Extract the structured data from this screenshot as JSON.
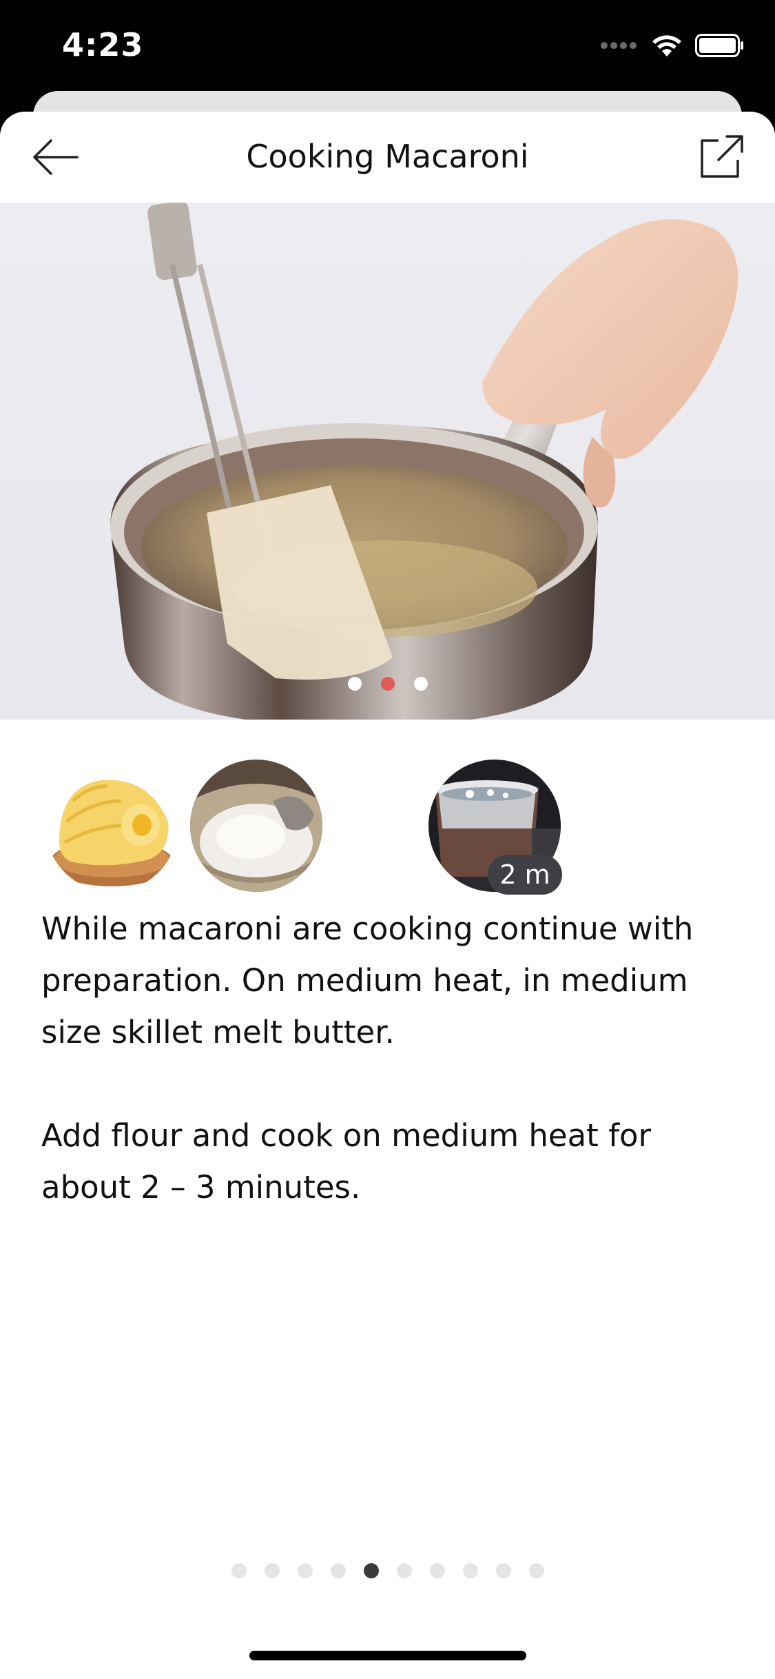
{
  "status_bar": {
    "time": "4:23"
  },
  "nav": {
    "title": "Cooking Macaroni",
    "back_icon": "arrow-left-icon",
    "share_icon": "share-external-icon"
  },
  "hero": {
    "image": "saucepan-with-spatula-melting-butter",
    "carousel_count": 3,
    "carousel_active_index": 1,
    "active_color": "#e05a57"
  },
  "ingredients": [
    {
      "name": "butter",
      "image": "butter-curl"
    },
    {
      "name": "flour",
      "image": "flour-sack-with-scoop"
    },
    {
      "name": "boiling water",
      "image": "pot-boiling-on-stove",
      "timer": "2 m"
    }
  ],
  "description": {
    "paragraph_1": "While macaroni are cooking continue with preparation. On medium heat, in medium size skillet melt butter.",
    "paragraph_2": "Add flour and cook on medium heat for about 2 – 3 minutes."
  },
  "step_pager": {
    "total_steps": 10,
    "active_index": 4
  }
}
